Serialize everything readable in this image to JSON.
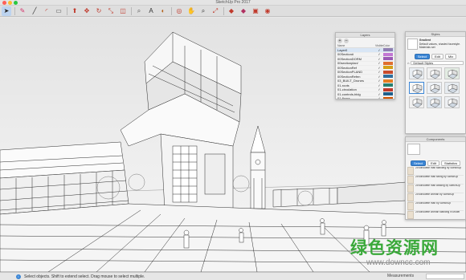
{
  "window": {
    "title": "SketchUp Pro 2017"
  },
  "toolbar": {
    "tools": [
      {
        "name": "select-tool-icon",
        "glyph": "➤",
        "color": "#222222",
        "selected": true
      },
      {
        "name": "eraser-tool-icon",
        "glyph": "✎",
        "color": "#d6336c"
      },
      {
        "name": "line-tool-icon",
        "glyph": "╱",
        "color": "#333333"
      },
      {
        "name": "arc-tool-icon",
        "glyph": "◜",
        "color": "#c0392b"
      },
      {
        "name": "rectangle-tool-icon",
        "glyph": "▭",
        "color": "#555555"
      },
      {
        "name": "push-pull-icon",
        "glyph": "⬆",
        "color": "#c0392b"
      },
      {
        "name": "move-tool-icon",
        "glyph": "✥",
        "color": "#c0392b"
      },
      {
        "name": "rotate-tool-icon",
        "glyph": "↻",
        "color": "#c0392b"
      },
      {
        "name": "scale-tool-icon",
        "glyph": "⤡",
        "color": "#c0392b"
      },
      {
        "name": "offset-tool-icon",
        "glyph": "◫",
        "color": "#c0392b"
      },
      {
        "name": "tape-measure-icon",
        "glyph": "⌕",
        "color": "#555555"
      },
      {
        "name": "text-tool-icon",
        "glyph": "A",
        "color": "#333333"
      },
      {
        "name": "paint-bucket-icon",
        "glyph": "◐",
        "color": "#b5651d"
      },
      {
        "name": "orbit-tool-icon",
        "glyph": "◎",
        "color": "#c0392b"
      },
      {
        "name": "pan-tool-icon",
        "glyph": "✋",
        "color": "#8e5a2b"
      },
      {
        "name": "zoom-tool-icon",
        "glyph": "⌕",
        "color": "#333333"
      },
      {
        "name": "zoom-extents-icon",
        "glyph": "⤢",
        "color": "#c0392b"
      },
      {
        "name": "3d-warehouse-icon",
        "glyph": "◆",
        "color": "#c0392b"
      },
      {
        "name": "extension-warehouse-icon",
        "glyph": "◆",
        "color": "#b03060"
      },
      {
        "name": "send-to-layout-icon",
        "glyph": "▣",
        "color": "#c0392b"
      },
      {
        "name": "extension-manager-icon",
        "glyph": "◉",
        "color": "#c0392b"
      }
    ]
  },
  "layers_panel": {
    "title": "Layers",
    "col_name": "Name",
    "col_visible": "Visible",
    "col_color": "Color",
    "add_glyph": "+",
    "remove_glyph": "–",
    "layers": [
      {
        "name": "Layer0",
        "visible": "✓",
        "color": "#8f7fb3"
      },
      {
        "name": "00Section#",
        "visible": "✓",
        "color": "#c277d4"
      },
      {
        "name": "00SectionDORM",
        "visible": "✓",
        "color": "#9b59b6"
      },
      {
        "name": "00sectionplan/",
        "visible": "✓",
        "color": "#e06f2e"
      },
      {
        "name": "00SectionRef",
        "visible": "✓",
        "color": "#d4a017"
      },
      {
        "name": "00SectionPLAND",
        "visible": "✓",
        "color": "#c94c2d"
      },
      {
        "name": "00SectionRefen",
        "visible": "✓",
        "color": "#2f6f9e"
      },
      {
        "name": "03_BUILT_Drones",
        "visible": "✓",
        "color": "#e67e22"
      },
      {
        "name": "01-roots",
        "visible": "✓",
        "color": "#27806f"
      },
      {
        "name": "01-circulation",
        "visible": "✓",
        "color": "#c0392b"
      },
      {
        "name": "01-controls-bldg",
        "visible": "✓",
        "color": "#1f5f8b"
      },
      {
        "name": "01-floors",
        "visible": "✓",
        "color": "#d35400"
      },
      {
        "name": "01-entourage",
        "visible": "✓",
        "color": "#e0a21b"
      }
    ]
  },
  "styles_panel": {
    "title": "Styles",
    "style_name": "Gradient",
    "style_desc": "Default values, shaded facestyle. Materials set",
    "tabs": [
      "Select",
      "Edit",
      "Mix"
    ],
    "active_tab": "Select",
    "selected_collection": "Default Styles",
    "home_glyph": "⌂"
  },
  "components_panel": {
    "title": "Components",
    "tabs": [
      "Select",
      "Edit",
      "Statistics"
    ],
    "active_tab": "Select",
    "items": [
      {
        "text": "2d silhouette man standing by SketchUp"
      },
      {
        "text": "2d silhouette man sitting by SketchUp"
      },
      {
        "text": "2d silhouette man walking by SketchUp"
      },
      {
        "text": "2d silhouette woman by SketchUp"
      },
      {
        "text": "2d silhouette man by SketchUp"
      },
      {
        "text": "2d silhouette woman standing in Model"
      }
    ]
  },
  "statusbar": {
    "icon_glyph": "i",
    "hint": "Select objects. Shift to extend select. Drag mouse to select multiple.",
    "measurements_label": "Measurements"
  },
  "watermark": {
    "logo": "绿色资源网",
    "url": "www.downcc.com"
  }
}
